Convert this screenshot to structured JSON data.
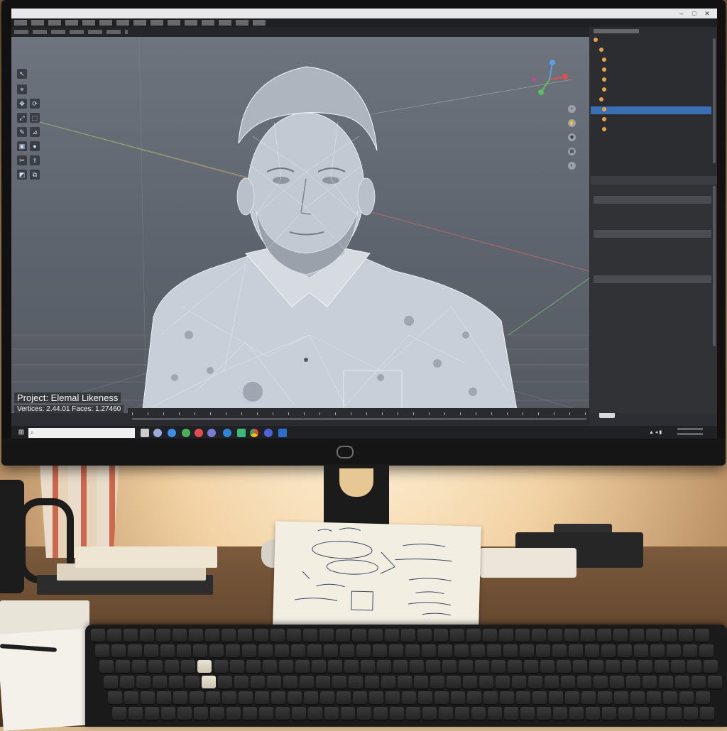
{
  "viewport": {
    "project_label": "Project: Elemal Likeness",
    "mesh_stats": "Vertices: 2.44.01 Faces: 1.27460"
  }
}
